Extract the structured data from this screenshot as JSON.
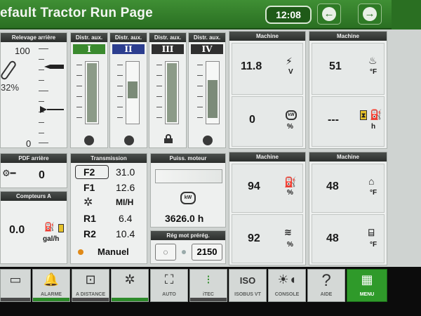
{
  "header": {
    "title": "efault Tractor Run Page",
    "clock": "12:08"
  },
  "rear_hitch": {
    "title": "Relevage arrière",
    "max": "100",
    "min": "0",
    "percent": "32%"
  },
  "aux": {
    "title": "Distr. aux.",
    "items": [
      {
        "label": "I",
        "color": "#3a8a2e"
      },
      {
        "label": "II",
        "color": "#2c3e8f"
      },
      {
        "label": "III",
        "color": "#2f2f2f"
      },
      {
        "label": "IV",
        "color": "#2f2f2f"
      }
    ]
  },
  "machine1": {
    "title": "Machine",
    "top_value": "11.8",
    "top_unit": "V",
    "bottom_value": "0",
    "bottom_unit": "%"
  },
  "machine2": {
    "title": "Machine",
    "top_value": "51",
    "top_unit": "°F",
    "bottom_value": "---",
    "bottom_unit": "h"
  },
  "pto": {
    "title": "PDF arrière",
    "value": "0"
  },
  "counters": {
    "title": "Compteurs A",
    "value": "0.0",
    "unit": "gal/h"
  },
  "transmission": {
    "title": "Transmission",
    "rows": [
      {
        "label": "F2",
        "value": "31.0"
      },
      {
        "label": "F1",
        "value": "12.6"
      },
      {
        "label": "",
        "value": "MI/H"
      },
      {
        "label": "R1",
        "value": "6.4"
      },
      {
        "label": "R2",
        "value": "10.4"
      }
    ],
    "mode": "Manuel"
  },
  "engine": {
    "title": "Puiss. moteur",
    "hours": "3626.0 h"
  },
  "preset": {
    "title": "Rég mot prérég.",
    "value": "2150"
  },
  "machine3": {
    "title": "Machine",
    "top_value": "94",
    "top_unit": "%",
    "bottom_value": "92",
    "bottom_unit": "%"
  },
  "machine4": {
    "title": "Machine",
    "top_value": "48",
    "top_unit": "°F",
    "bottom_value": "48",
    "bottom_unit": "°F"
  },
  "softkeys": {
    "k2": "ALARME",
    "k3": "A DISTANCE",
    "k5": "AUTO",
    "k6": "iTEC",
    "k7": "ISOBUS VT",
    "k8": "CONSOLE",
    "k9": "AIDE",
    "k10": "MENU"
  },
  "colors": {
    "accent": "#2a6f22",
    "menu": "#2f9a2a"
  }
}
